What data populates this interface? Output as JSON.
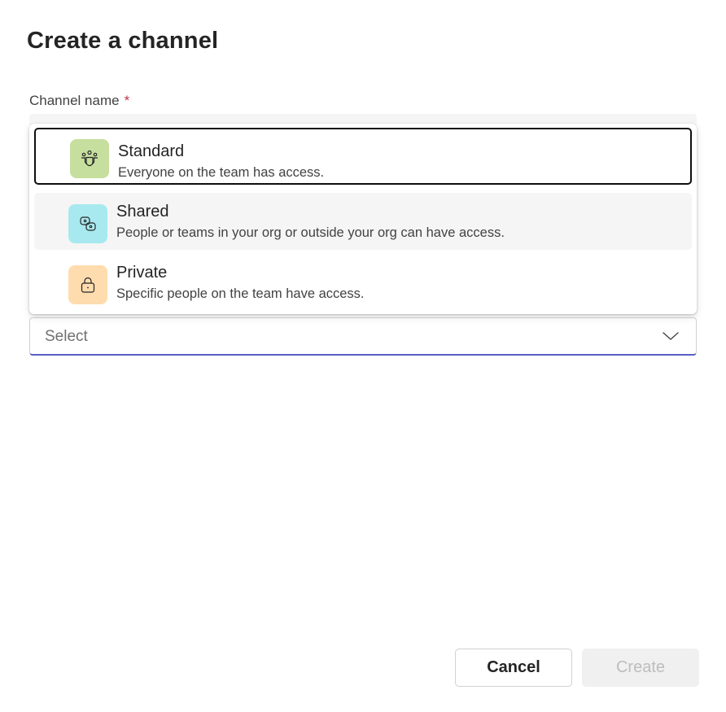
{
  "dialog": {
    "title": "Create a channel"
  },
  "channel_name": {
    "label": "Channel name",
    "required_mark": "*"
  },
  "privacy": {
    "options": [
      {
        "title": "Standard",
        "description": "Everyone on the team has access.",
        "icon": "people-team-icon",
        "icon_bg": "#c6df9e",
        "state": "focused"
      },
      {
        "title": "Shared",
        "description": "People or teams in your org or outside your org can have access.",
        "icon": "shared-link-icon",
        "icon_bg": "#a8e9ef",
        "state": "hovered"
      },
      {
        "title": "Private",
        "description": "Specific people on the team have access.",
        "icon": "lock-icon",
        "icon_bg": "#ffdcae",
        "state": "default"
      }
    ],
    "select_placeholder": "Select",
    "chevron_icon": "chevron-down-icon"
  },
  "footer": {
    "cancel_label": "Cancel",
    "create_label": "Create"
  },
  "colors": {
    "accent": "#5b5fc7",
    "required": "#c4314b",
    "focus_outline": "#0f0f0f",
    "disabled_bg": "#f0f0f0",
    "disabled_text": "#bdbdbd"
  }
}
